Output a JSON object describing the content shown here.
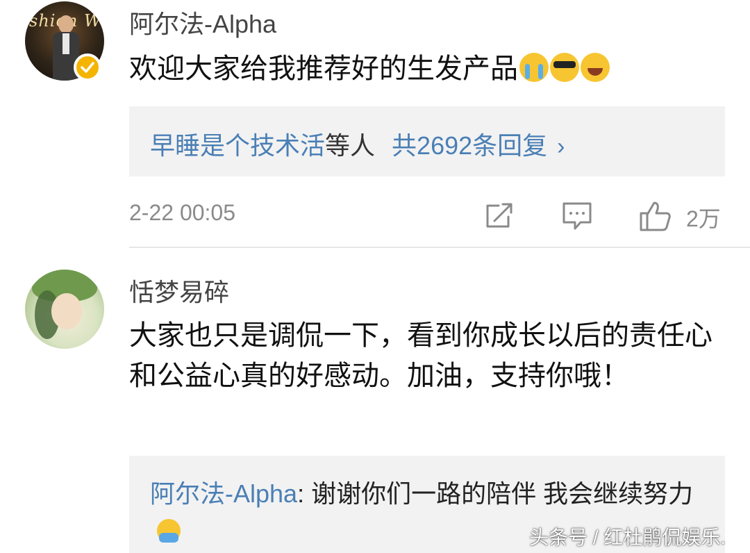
{
  "comment1": {
    "username": "阿尔法-Alpha",
    "text": "欢迎大家给我推荐好的生发产品",
    "emojis": [
      "crying-face-emoji",
      "sunglasses-face-emoji",
      "laughing-tears-emoji"
    ],
    "avatar_text": "shion W",
    "verified": true,
    "replies_summary": {
      "user_link": "早睡是个技术活",
      "middle": "等人",
      "count_link": "共2692条回复",
      "chevron": "›"
    },
    "timestamp": "2-22 00:05",
    "like_count": "2万",
    "icons": [
      "forward-icon",
      "comment-icon",
      "like-icon"
    ]
  },
  "comment2": {
    "username": "恬梦易碎",
    "text": "大家也只是调侃一下，看到你成长以后的责任心和公益心真的好感动。加油，支持你哦！",
    "reply": {
      "user": "阿尔法-Alpha",
      "separator": ": ",
      "text": "谢谢你们一路的陪伴 我会继续努力",
      "emoji": "hug-emoji"
    }
  },
  "watermark": "头条号 / 红杜鹃侃娱乐.",
  "colors": {
    "link": "#4a7fb5",
    "reply_bg": "#f2f2f2",
    "meta": "#8a8a8a",
    "verified": "#f4b400"
  }
}
